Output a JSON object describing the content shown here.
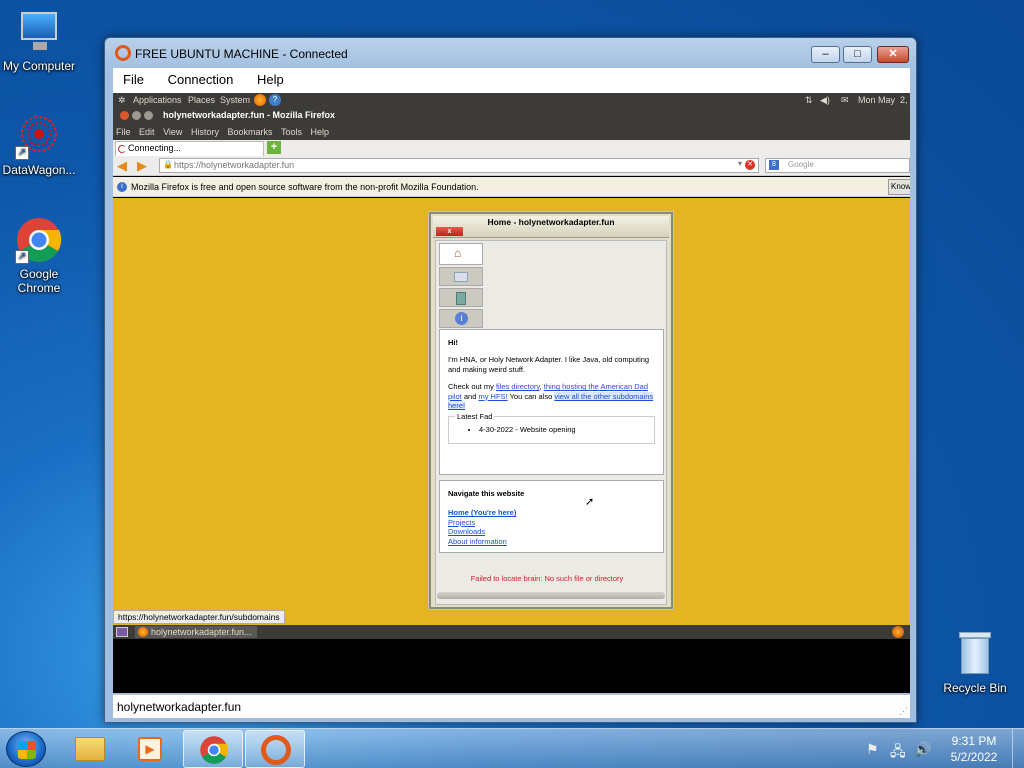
{
  "desktop": {
    "icons": [
      {
        "label": "My Computer"
      },
      {
        "label": "DataWagon..."
      },
      {
        "label": "Google Chrome"
      },
      {
        "label": "Recycle Bin"
      }
    ]
  },
  "rdp_window": {
    "title": "FREE UBUNTU MACHINE - Connected",
    "controls": {
      "minimize": "–",
      "maximize": "□",
      "close": "✕"
    },
    "menu": [
      "File",
      "Connection",
      "Help"
    ],
    "status_text": "holynetworkadapter.fun"
  },
  "ubuntu": {
    "panel": {
      "applications": "Applications",
      "places": "Places",
      "system": "System",
      "clock": "Mon May  2,"
    },
    "firefox": {
      "window_title": "holynetworkadapter.fun - Mozilla Firefox",
      "menu": [
        "File",
        "Edit",
        "View",
        "History",
        "Bookmarks",
        "Tools",
        "Help"
      ],
      "tab_label": "Connecting...",
      "new_tab": "+",
      "url": "https://holynetworkadapter.fun",
      "search_placeholder": "Google",
      "info_bar": "Mozilla Firefox is free and open source software from the non-profit Mozilla Foundation.",
      "info_button": "Know",
      "status_url": "https://holynetworkadapter.fun/subdomains"
    },
    "taskbar_item": "holynetworkadapter.fun..."
  },
  "site": {
    "window_title": "Home - holynetworkadapter.fun",
    "close_label": "x",
    "greeting": "Hi!",
    "intro": "I'm HNA, or Holy Network Adapter. I like Java, old computing and making weird stuff.",
    "checkout_prefix": "Check out my",
    "link_files": "files directory",
    "comma": ",",
    "link_thing": "thing hosting the American Dad pilot",
    "and": "and",
    "link_hfs": "my HFS!",
    "you_can_also": "You can also",
    "link_subdomains": "view all the other subdomains here!",
    "latest_legend": "Latest Fad",
    "latest_items": [
      "4-30-2022 - Website opening"
    ],
    "nav_title": "Navigate this website",
    "nav_links": [
      "Home (You're here)",
      "Projects",
      "Downloads",
      "About information"
    ],
    "error": "Failed to locate brain: No such file or directory"
  },
  "taskbar": {
    "time": "9:31 PM",
    "date": "5/2/2022"
  },
  "colors": {
    "site_background": "#e4b521",
    "link": "#1a4fd6",
    "error": "#d0212a"
  }
}
